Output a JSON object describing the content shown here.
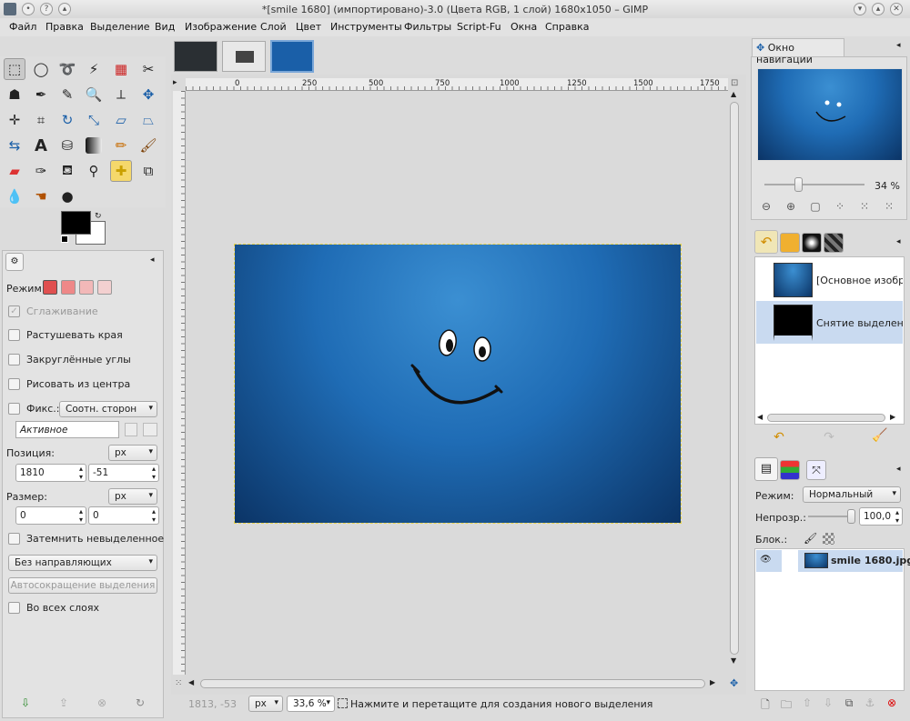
{
  "window": {
    "title": "*[smile 1680] (импортировано)-3.0 (Цвета RGB, 1 слой) 1680x1050 – GIMP"
  },
  "menu": [
    "Файл",
    "Правка",
    "Выделение",
    "Вид",
    "Изображение",
    "Слой",
    "Цвет",
    "Инструменты",
    "Фильтры",
    "Script-Fu",
    "Окна",
    "Справка"
  ],
  "tool_options": {
    "mode_label": "Режим:",
    "antialias": "Сглаживание",
    "feather": "Растушевать края",
    "rounded": "Закруглённые углы",
    "from_center": "Рисовать из центра",
    "fixed_label": "Фикс.:",
    "fixed_value": "Соотн. сторон",
    "fixed_input": "Активное",
    "position_label": "Позиция:",
    "position_unit": "px",
    "pos_x": "1810",
    "pos_y": "-51",
    "size_label": "Размер:",
    "size_unit": "px",
    "size_w": "0",
    "size_h": "0",
    "highlight": "Затемнить невыделенное",
    "guides": "Без направляющих",
    "autoshrink": "Автосокращение выделения",
    "merged": "Во всех слоях"
  },
  "ruler": {
    "labels": [
      "0",
      "250",
      "500",
      "750",
      "1000",
      "1250",
      "1500",
      "1750"
    ]
  },
  "status": {
    "coords": "1813, -53",
    "unit": "px",
    "zoom": "33,6 %",
    "message": "Нажмите и перетащите для создания нового выделения"
  },
  "navigation": {
    "tab": "Окно навигации",
    "zoom": "34 %"
  },
  "undo": {
    "items": [
      "[Основное изобра",
      "Снятие выделения"
    ]
  },
  "layers": {
    "mode_label": "Режим:",
    "mode_value": "Нормальный",
    "opacity_label": "Непрозр.:",
    "opacity_value": "100,0",
    "lock_label": "Блок.:",
    "layer_name": "smile 1680.jpg"
  },
  "colors": {
    "accent": "#1a5fa8",
    "image_light": "#3b8fd2",
    "image_dark": "#0b3466"
  }
}
